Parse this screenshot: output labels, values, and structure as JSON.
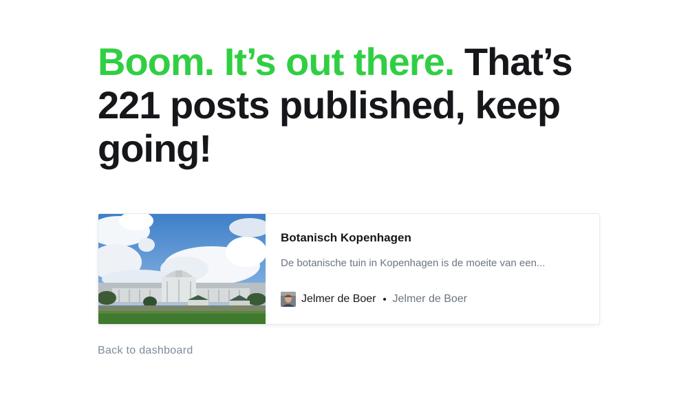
{
  "headline": {
    "accent_text": "Boom. It’s out there.",
    "main_text": " That’s 221 posts published, keep going!",
    "accent_color": "#30cf43",
    "text_color": "#15171a"
  },
  "post_card": {
    "title": "Botanisch Kopenhagen",
    "excerpt": "De botanische tuin in Kopenhagen is de moeite van een...",
    "author_name": "Jelmer de Boer",
    "author_secondary": "Jelmer de Boer",
    "image_icon": "photo-botanical-garden-icon",
    "avatar_icon": "author-avatar-icon"
  },
  "footer": {
    "back_link_label": "Back to dashboard"
  }
}
